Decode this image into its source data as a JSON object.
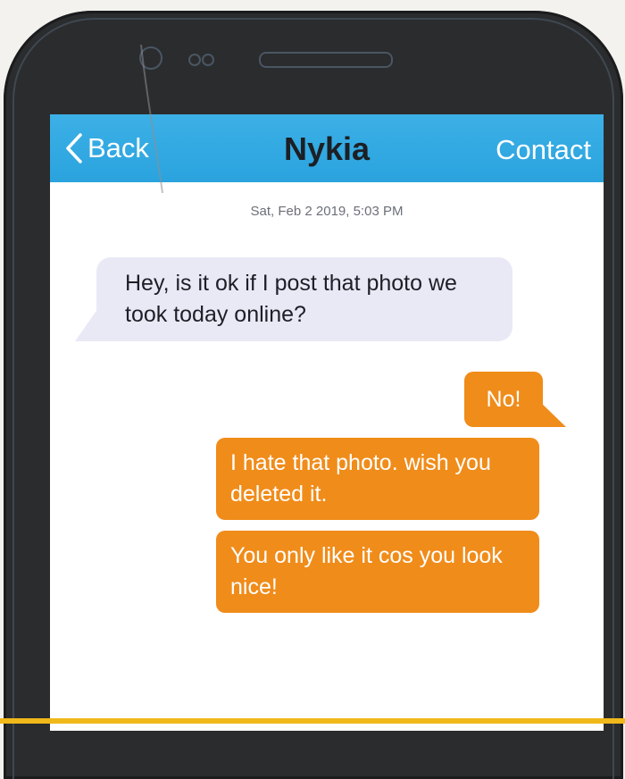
{
  "navbar": {
    "back_label": "Back",
    "title": "Nykia",
    "contact_label": "Contact"
  },
  "conversation": {
    "timestamp": "Sat, Feb 2 2019, 5:03 PM",
    "messages": [
      {
        "from": "contact",
        "text": "Hey, is it ok if I post that photo we took today online?"
      },
      {
        "from": "me",
        "text": "No!"
      },
      {
        "from": "me",
        "text": "I hate that photo. wish you deleted it."
      },
      {
        "from": "me",
        "text": "You only like it cos you look nice!"
      }
    ]
  },
  "icons": {
    "back": "chevron-left-icon",
    "camera": "front-camera-icon",
    "speaker": "earpiece-speaker-icon"
  },
  "colors": {
    "navbar": "#2aa3de",
    "incoming_bubble": "#e9e9f6",
    "outgoing_bubble": "#f08c1a",
    "phone_body": "#2b2c2e"
  }
}
